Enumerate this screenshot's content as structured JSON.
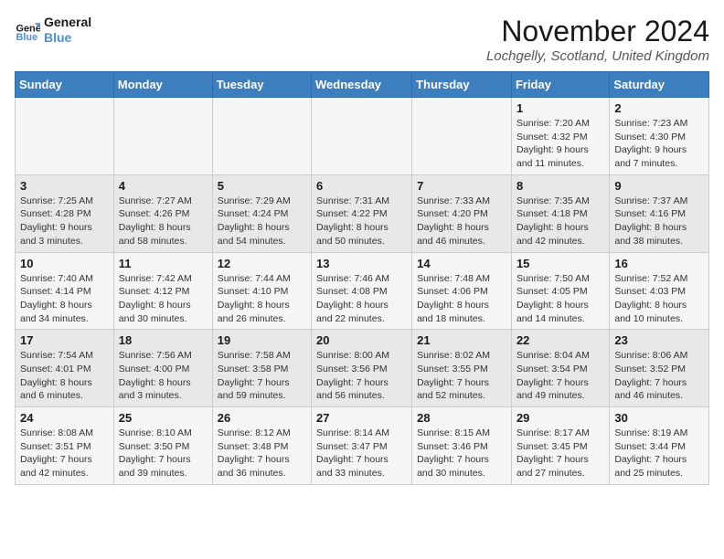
{
  "logo": {
    "line1": "General",
    "line2": "Blue"
  },
  "title": "November 2024",
  "location": "Lochgelly, Scotland, United Kingdom",
  "days_header": [
    "Sunday",
    "Monday",
    "Tuesday",
    "Wednesday",
    "Thursday",
    "Friday",
    "Saturday"
  ],
  "weeks": [
    [
      {
        "day": "",
        "sunrise": "",
        "sunset": "",
        "daylight": ""
      },
      {
        "day": "",
        "sunrise": "",
        "sunset": "",
        "daylight": ""
      },
      {
        "day": "",
        "sunrise": "",
        "sunset": "",
        "daylight": ""
      },
      {
        "day": "",
        "sunrise": "",
        "sunset": "",
        "daylight": ""
      },
      {
        "day": "",
        "sunrise": "",
        "sunset": "",
        "daylight": ""
      },
      {
        "day": "1",
        "sunrise": "Sunrise: 7:20 AM",
        "sunset": "Sunset: 4:32 PM",
        "daylight": "Daylight: 9 hours and 11 minutes."
      },
      {
        "day": "2",
        "sunrise": "Sunrise: 7:23 AM",
        "sunset": "Sunset: 4:30 PM",
        "daylight": "Daylight: 9 hours and 7 minutes."
      }
    ],
    [
      {
        "day": "3",
        "sunrise": "Sunrise: 7:25 AM",
        "sunset": "Sunset: 4:28 PM",
        "daylight": "Daylight: 9 hours and 3 minutes."
      },
      {
        "day": "4",
        "sunrise": "Sunrise: 7:27 AM",
        "sunset": "Sunset: 4:26 PM",
        "daylight": "Daylight: 8 hours and 58 minutes."
      },
      {
        "day": "5",
        "sunrise": "Sunrise: 7:29 AM",
        "sunset": "Sunset: 4:24 PM",
        "daylight": "Daylight: 8 hours and 54 minutes."
      },
      {
        "day": "6",
        "sunrise": "Sunrise: 7:31 AM",
        "sunset": "Sunset: 4:22 PM",
        "daylight": "Daylight: 8 hours and 50 minutes."
      },
      {
        "day": "7",
        "sunrise": "Sunrise: 7:33 AM",
        "sunset": "Sunset: 4:20 PM",
        "daylight": "Daylight: 8 hours and 46 minutes."
      },
      {
        "day": "8",
        "sunrise": "Sunrise: 7:35 AM",
        "sunset": "Sunset: 4:18 PM",
        "daylight": "Daylight: 8 hours and 42 minutes."
      },
      {
        "day": "9",
        "sunrise": "Sunrise: 7:37 AM",
        "sunset": "Sunset: 4:16 PM",
        "daylight": "Daylight: 8 hours and 38 minutes."
      }
    ],
    [
      {
        "day": "10",
        "sunrise": "Sunrise: 7:40 AM",
        "sunset": "Sunset: 4:14 PM",
        "daylight": "Daylight: 8 hours and 34 minutes."
      },
      {
        "day": "11",
        "sunrise": "Sunrise: 7:42 AM",
        "sunset": "Sunset: 4:12 PM",
        "daylight": "Daylight: 8 hours and 30 minutes."
      },
      {
        "day": "12",
        "sunrise": "Sunrise: 7:44 AM",
        "sunset": "Sunset: 4:10 PM",
        "daylight": "Daylight: 8 hours and 26 minutes."
      },
      {
        "day": "13",
        "sunrise": "Sunrise: 7:46 AM",
        "sunset": "Sunset: 4:08 PM",
        "daylight": "Daylight: 8 hours and 22 minutes."
      },
      {
        "day": "14",
        "sunrise": "Sunrise: 7:48 AM",
        "sunset": "Sunset: 4:06 PM",
        "daylight": "Daylight: 8 hours and 18 minutes."
      },
      {
        "day": "15",
        "sunrise": "Sunrise: 7:50 AM",
        "sunset": "Sunset: 4:05 PM",
        "daylight": "Daylight: 8 hours and 14 minutes."
      },
      {
        "day": "16",
        "sunrise": "Sunrise: 7:52 AM",
        "sunset": "Sunset: 4:03 PM",
        "daylight": "Daylight: 8 hours and 10 minutes."
      }
    ],
    [
      {
        "day": "17",
        "sunrise": "Sunrise: 7:54 AM",
        "sunset": "Sunset: 4:01 PM",
        "daylight": "Daylight: 8 hours and 6 minutes."
      },
      {
        "day": "18",
        "sunrise": "Sunrise: 7:56 AM",
        "sunset": "Sunset: 4:00 PM",
        "daylight": "Daylight: 8 hours and 3 minutes."
      },
      {
        "day": "19",
        "sunrise": "Sunrise: 7:58 AM",
        "sunset": "Sunset: 3:58 PM",
        "daylight": "Daylight: 7 hours and 59 minutes."
      },
      {
        "day": "20",
        "sunrise": "Sunrise: 8:00 AM",
        "sunset": "Sunset: 3:56 PM",
        "daylight": "Daylight: 7 hours and 56 minutes."
      },
      {
        "day": "21",
        "sunrise": "Sunrise: 8:02 AM",
        "sunset": "Sunset: 3:55 PM",
        "daylight": "Daylight: 7 hours and 52 minutes."
      },
      {
        "day": "22",
        "sunrise": "Sunrise: 8:04 AM",
        "sunset": "Sunset: 3:54 PM",
        "daylight": "Daylight: 7 hours and 49 minutes."
      },
      {
        "day": "23",
        "sunrise": "Sunrise: 8:06 AM",
        "sunset": "Sunset: 3:52 PM",
        "daylight": "Daylight: 7 hours and 46 minutes."
      }
    ],
    [
      {
        "day": "24",
        "sunrise": "Sunrise: 8:08 AM",
        "sunset": "Sunset: 3:51 PM",
        "daylight": "Daylight: 7 hours and 42 minutes."
      },
      {
        "day": "25",
        "sunrise": "Sunrise: 8:10 AM",
        "sunset": "Sunset: 3:50 PM",
        "daylight": "Daylight: 7 hours and 39 minutes."
      },
      {
        "day": "26",
        "sunrise": "Sunrise: 8:12 AM",
        "sunset": "Sunset: 3:48 PM",
        "daylight": "Daylight: 7 hours and 36 minutes."
      },
      {
        "day": "27",
        "sunrise": "Sunrise: 8:14 AM",
        "sunset": "Sunset: 3:47 PM",
        "daylight": "Daylight: 7 hours and 33 minutes."
      },
      {
        "day": "28",
        "sunrise": "Sunrise: 8:15 AM",
        "sunset": "Sunset: 3:46 PM",
        "daylight": "Daylight: 7 hours and 30 minutes."
      },
      {
        "day": "29",
        "sunrise": "Sunrise: 8:17 AM",
        "sunset": "Sunset: 3:45 PM",
        "daylight": "Daylight: 7 hours and 27 minutes."
      },
      {
        "day": "30",
        "sunrise": "Sunrise: 8:19 AM",
        "sunset": "Sunset: 3:44 PM",
        "daylight": "Daylight: 7 hours and 25 minutes."
      }
    ]
  ]
}
